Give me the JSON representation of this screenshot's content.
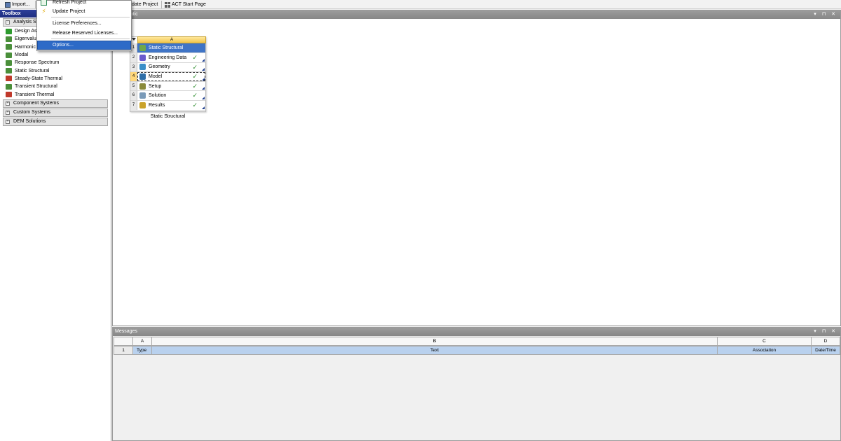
{
  "toolbar": {
    "import_label": "Import...",
    "update_project_label": "date Project",
    "act_start_label": "ACT Start Page"
  },
  "menu": {
    "items": [
      {
        "label": "Refresh Project",
        "icon": "refresh-icon"
      },
      {
        "label": "Update Project",
        "icon": "lightning-icon"
      },
      {
        "label": "License Preferences..."
      },
      {
        "label": "Release Reserved Licenses..."
      },
      {
        "label": "Options..."
      }
    ],
    "selected": "Options..."
  },
  "toolbox": {
    "title": "Toolbox",
    "analysis_group": "Analysis Sy",
    "analysis_items": [
      {
        "label": "Design As",
        "color": "#2e9b2e"
      },
      {
        "label": "Eigenvalu",
        "color": "#4a8f3a"
      },
      {
        "label": "Harmonic",
        "color": "#4a8f3a"
      },
      {
        "label": "Modal",
        "color": "#4a8f3a"
      },
      {
        "label": "Response Spectrum",
        "color": "#4a8f3a"
      },
      {
        "label": "Static Structural",
        "color": "#4a8f3a"
      },
      {
        "label": "Steady-State Thermal",
        "color": "#c0392b"
      },
      {
        "label": "Transient Structural",
        "color": "#4a8f3a"
      },
      {
        "label": "Transient Thermal",
        "color": "#c0392b"
      }
    ],
    "groups": [
      {
        "label": "Component Systems"
      },
      {
        "label": "Custom Systems"
      },
      {
        "label": "DEM Solutions"
      }
    ]
  },
  "schematic": {
    "title": "Schematic",
    "system": {
      "column_label": "A",
      "caption": "Static Structural",
      "cells": [
        {
          "num": "1",
          "label": "Static Structural",
          "check": "",
          "color": "#6fa84a"
        },
        {
          "num": "2",
          "label": "Engineering Data",
          "check": "✓",
          "color": "#6a5acd"
        },
        {
          "num": "3",
          "label": "Geometry",
          "check": "✓",
          "color": "#3a8fc9"
        },
        {
          "num": "4",
          "label": "Model",
          "check": "✓",
          "color": "#2f6fa8"
        },
        {
          "num": "5",
          "label": "Setup",
          "check": "✓",
          "color": "#8a8a3a"
        },
        {
          "num": "6",
          "label": "Solution",
          "check": "✓",
          "color": "#7a9ab8"
        },
        {
          "num": "7",
          "label": "Results",
          "check": "✓",
          "color": "#c9a22a"
        }
      ]
    }
  },
  "messages": {
    "title": "Messages",
    "col_letters": [
      "A",
      "B",
      "C",
      "D"
    ],
    "row": {
      "num": "1",
      "type": "Type",
      "text": "Text",
      "association": "Association",
      "datetime": "Date/Time"
    }
  }
}
